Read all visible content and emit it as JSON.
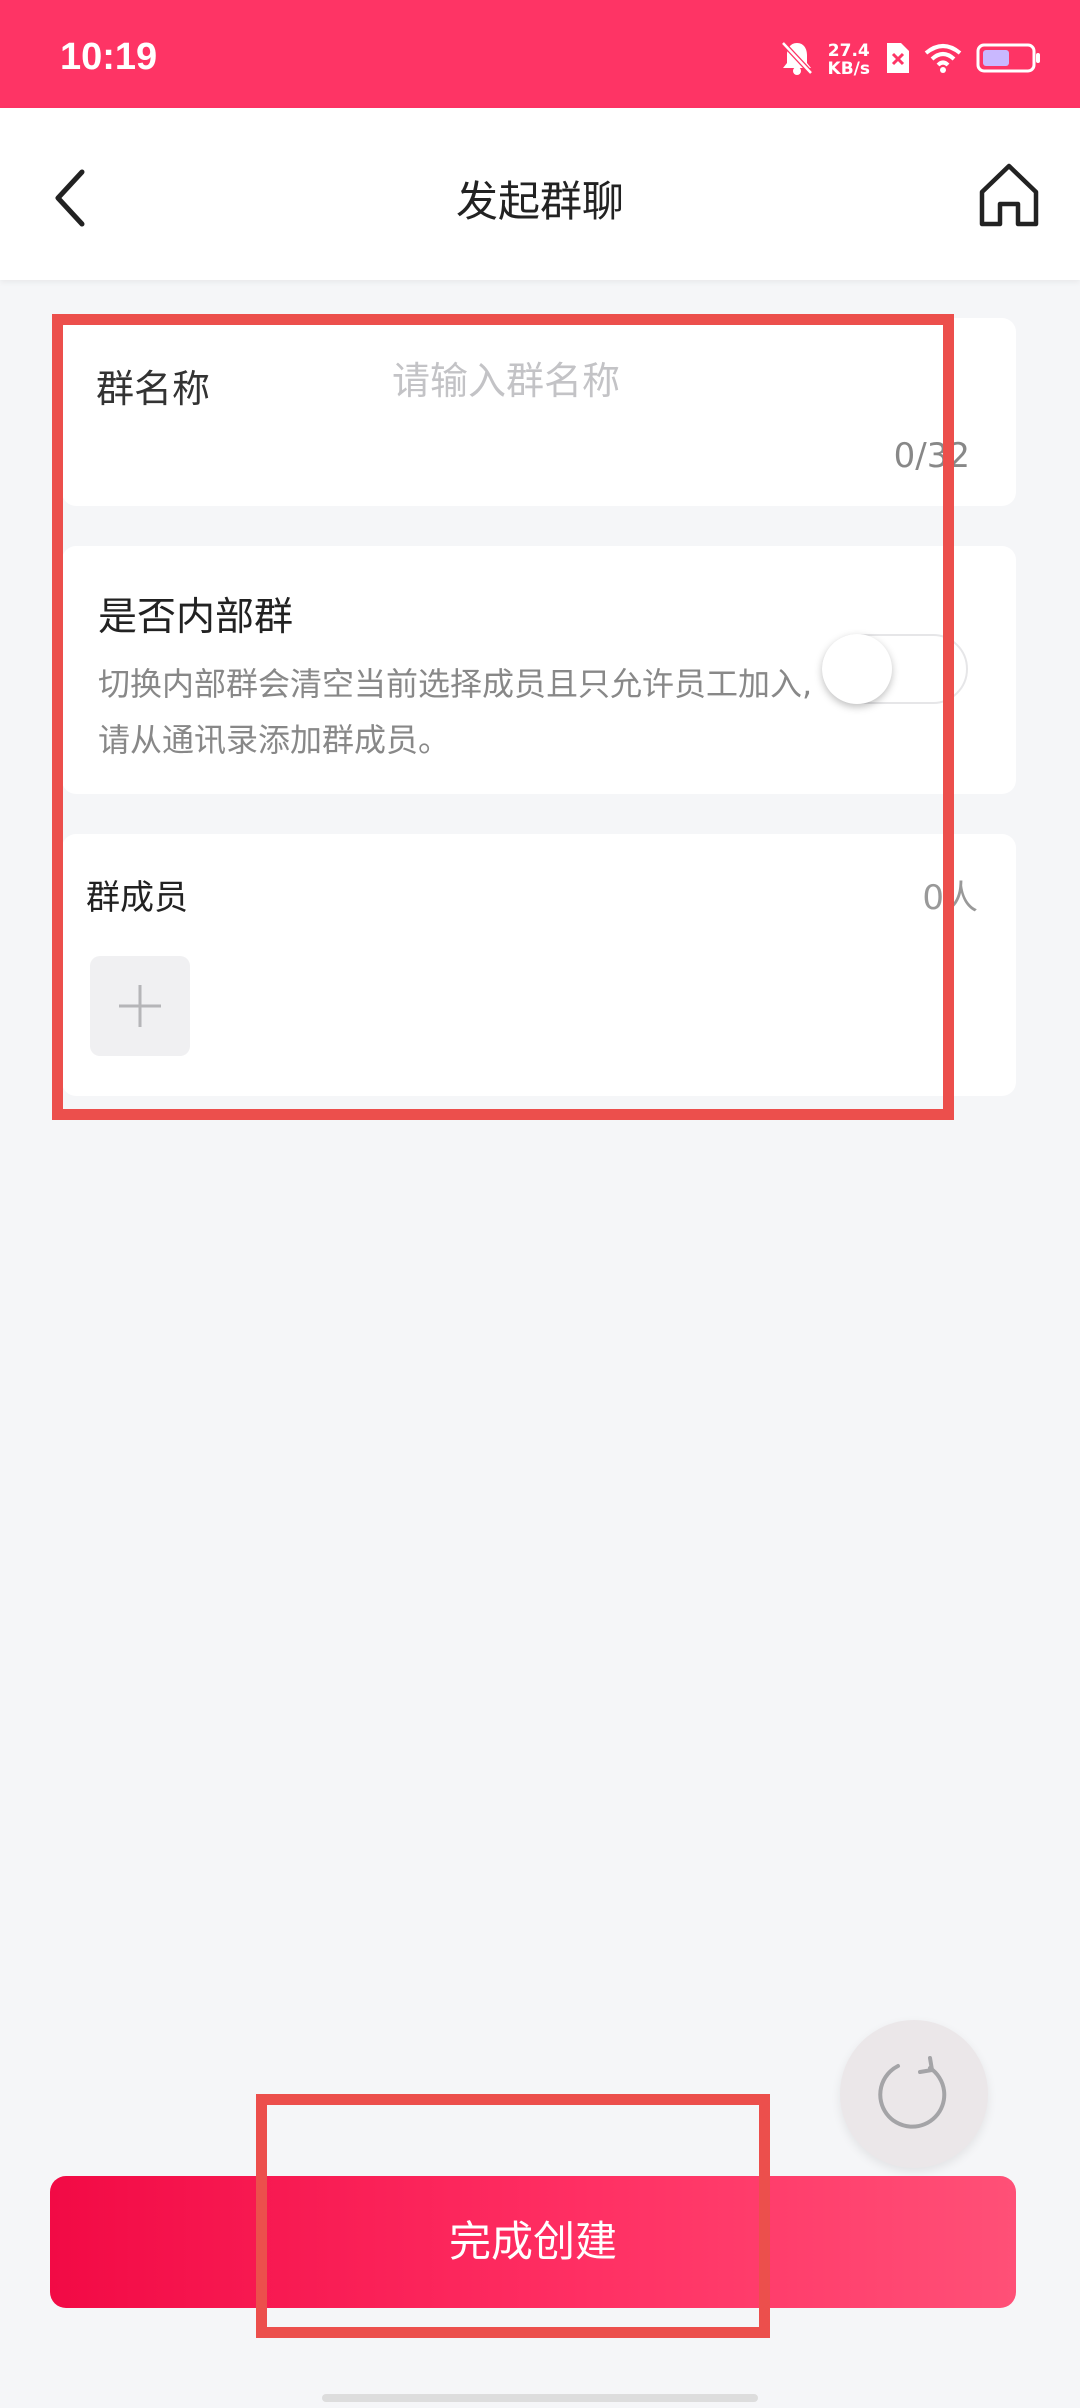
{
  "status_bar": {
    "time": "10:19",
    "net_speed_value": "27.4",
    "net_speed_unit": "KB/s",
    "accent_color": "#fe3465"
  },
  "header": {
    "title": "发起群聊",
    "back_icon": "back-arrow-icon",
    "home_icon": "home-icon"
  },
  "group_name": {
    "label": "群名称",
    "placeholder": "请输入群名称",
    "value": "",
    "counter": "0/32"
  },
  "internal_group": {
    "title": "是否内部群",
    "description": "切换内部群会清空当前选择成员且只允许员工加入,请从通讯录添加群成员。",
    "enabled": false
  },
  "members": {
    "label": "群成员",
    "count": "0人",
    "add_icon": "plus-icon"
  },
  "actions": {
    "submit_label": "完成创建",
    "refresh_icon": "refresh-icon"
  },
  "colors": {
    "primary": "#f20a45",
    "annotation": "#ec4f4c"
  }
}
